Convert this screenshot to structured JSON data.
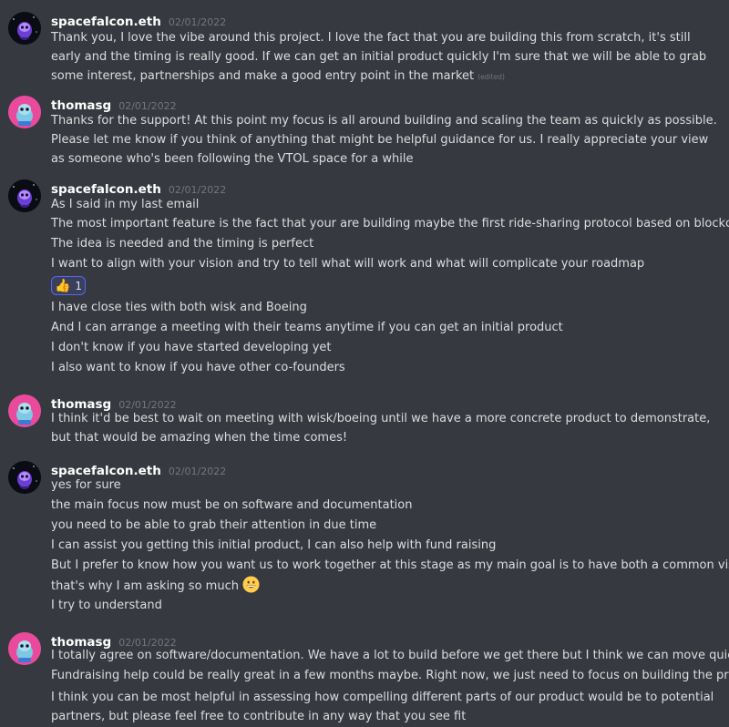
{
  "users": {
    "falcon": {
      "name": "spacefalcon.eth",
      "avatar_icon": "falcon-avatar-icon"
    },
    "thomas": {
      "name": "thomasg",
      "avatar_icon": "thomas-avatar-icon"
    }
  },
  "messages": [
    {
      "author": "spacefalcon.eth",
      "timestamp": "02/01/2022",
      "lines": [
        "Thank you, I love the vibe around this project. I love the fact that you are building this from scratch, it's still early and the timing is really good. If we can get an initial product quickly I'm sure that we will be able to grab some interest, partnerships and make a good entry point in the market"
      ],
      "edited_label": "(edited)"
    },
    {
      "author": "thomasg",
      "timestamp": "02/01/2022",
      "lines": [
        "Thanks for the support! At this point my focus is all around building and scaling the team as quickly as possible. Please let me know if you think of anything that might be helpful guidance for us. I really appreciate your view as someone who's been following the VTOL space for a while"
      ]
    },
    {
      "author": "spacefalcon.eth",
      "timestamp": "02/01/2022",
      "lines": [
        "As I said in my last email",
        "The most important feature is the fact that your are building maybe the first ride-sharing protocol based on blockchain",
        "The idea is needed and the timing is perfect",
        "I want to align with your vision and try to tell what will work and what will complicate your roadmap",
        "I have close ties with both wisk and Boeing",
        "And I can arrange a meeting with their teams anytime if you can get an initial product",
        "I don't know if you have started developing yet",
        "I also want to know if you have other co-founders"
      ],
      "reaction": {
        "emoji": "👍",
        "emoji_icon": "thumbs-up-icon",
        "count": "1"
      }
    },
    {
      "author": "thomasg",
      "timestamp": "02/01/2022",
      "lines": [
        "I think it'd be best to wait on meeting with wisk/boeing until we have a more concrete product to demonstrate, but that would be amazing when the time comes!"
      ]
    },
    {
      "author": "spacefalcon.eth",
      "timestamp": "02/01/2022",
      "lines": [
        "yes for sure",
        "the main focus now must be on software and documentation",
        "you need to be able to grab their attention in due time",
        "I can assist you getting this initial product, I can also help with fund raising",
        "But I prefer to know how you want us to work together at this stage as my main goal is to have both a common vision",
        "that's why I am asking so much",
        "I try to understand"
      ],
      "inline_emoji_icon": "grinning-face-icon"
    },
    {
      "author": "thomasg",
      "timestamp": "02/01/2022",
      "lines": [
        "I totally agree on software/documentation. We have a lot to build before we get there but I think we can move quickly.",
        "Fundraising help could be really great in a few months maybe. Right now, we just need to focus on building the product",
        "I think you can be most helpful in assessing how compelling different parts of our product would be to potential partners, but please feel free to contribute in any way that you see fit"
      ]
    }
  ]
}
